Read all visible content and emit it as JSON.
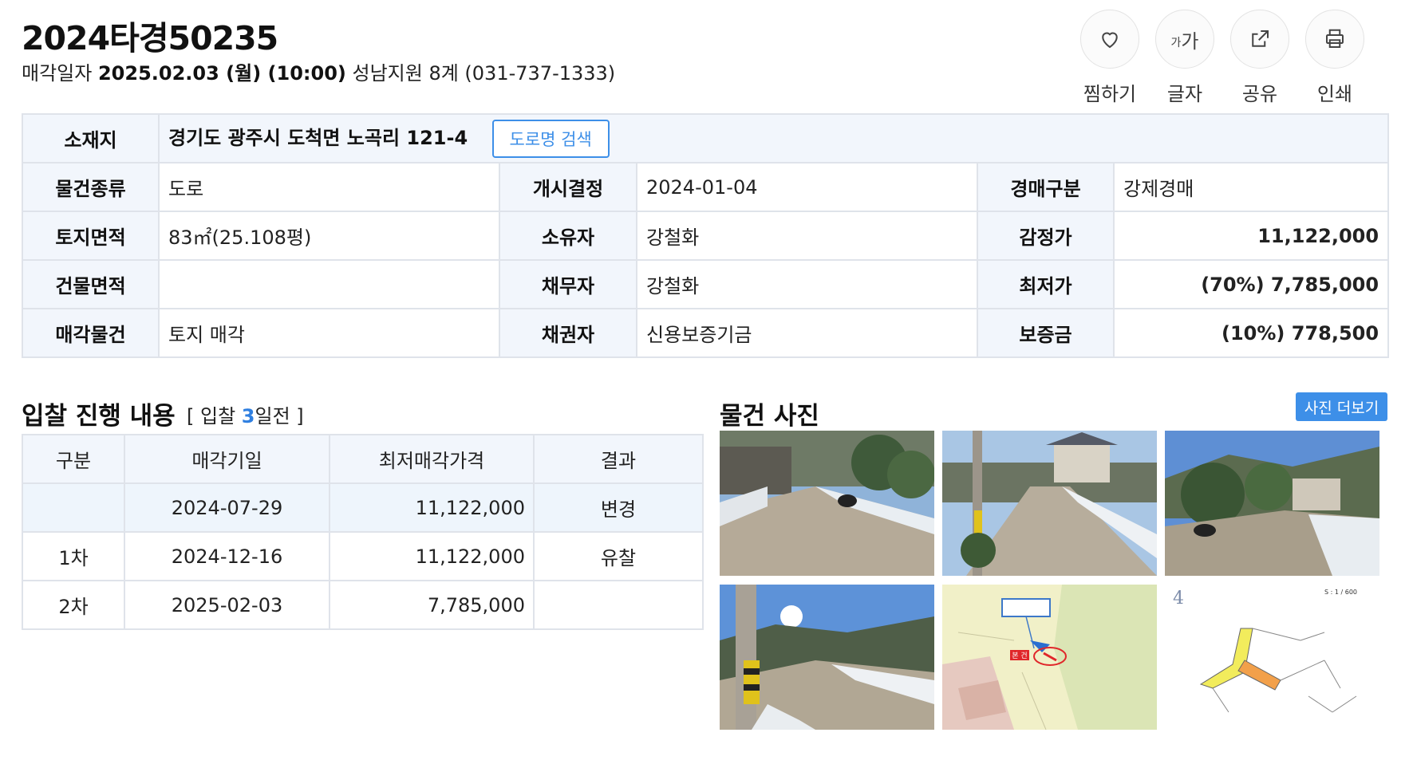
{
  "header": {
    "case_number": "2024타경50235",
    "sale_date_prefix": "매각일자",
    "sale_date": "2025.02.03 (월) (10:00)",
    "court": "성남지원 8계 (031-737-1333)"
  },
  "actions": [
    {
      "label": "찜하기",
      "icon": "heart-icon"
    },
    {
      "label": "글자",
      "icon": "font-size-icon",
      "glyph_small": "가",
      "glyph_large": "가"
    },
    {
      "label": "공유",
      "icon": "share-icon"
    },
    {
      "label": "인쇄",
      "icon": "print-icon"
    }
  ],
  "info": {
    "address_label": "소재지",
    "address": "경기도 광주시 도척면 노곡리 121-4",
    "road_search_button": "도로명 검색",
    "rows": [
      {
        "l1": "물건종류",
        "v1": "도로",
        "l2": "개시결정",
        "v2": "2024-01-04",
        "l3": "경매구분",
        "v3": "강제경매"
      },
      {
        "l1": "토지면적",
        "v1": "83㎡(25.108평)",
        "l2": "소유자",
        "v2": "강철화",
        "l3": "감정가",
        "v3": "11,122,000"
      },
      {
        "l1": "건물면적",
        "v1": "",
        "l2": "채무자",
        "v2": "강철화",
        "l3": "최저가",
        "v3": "(70%) 7,785,000"
      },
      {
        "l1": "매각물건",
        "v1": "토지 매각",
        "l2": "채권자",
        "v2": "신용보증기금",
        "l3": "보증금",
        "v3": "(10%) 778,500"
      }
    ]
  },
  "bid": {
    "title": "입찰 진행 내용",
    "sub_prefix": "[ 입찰 ",
    "sub_count": "3",
    "sub_suffix": "일전 ]",
    "headers": [
      "구분",
      "매각기일",
      "최저매각가격",
      "결과"
    ],
    "rows": [
      {
        "round": "",
        "date": "2024-07-29",
        "price": "11,122,000",
        "result": "변경"
      },
      {
        "round": "1차",
        "date": "2024-12-16",
        "price": "11,122,000",
        "result": "유찰"
      },
      {
        "round": "2차",
        "date": "2025-02-03",
        "price": "7,785,000",
        "result": ""
      }
    ]
  },
  "photos": {
    "title": "물건 사진",
    "more_button": "사진 더보기",
    "map_scale_text": "S : 1 / 600",
    "map_number": "4",
    "map_label": "본 건",
    "accent_color": "#3d8fe8"
  }
}
